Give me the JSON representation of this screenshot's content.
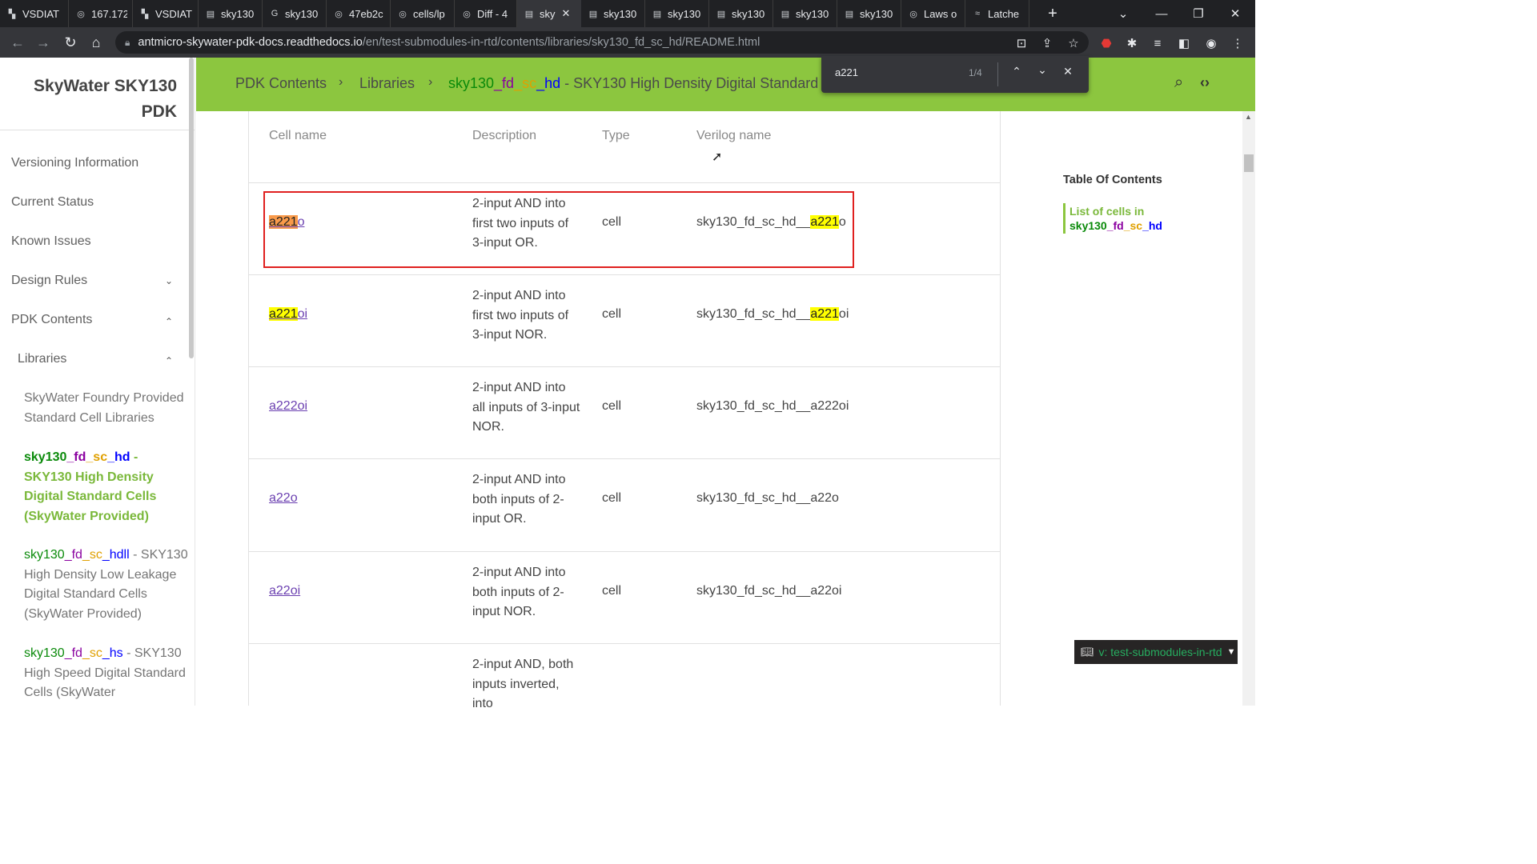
{
  "tabs": [
    {
      "label": "VSDIAT",
      "icon": "vsdiat-icon",
      "width": 86
    },
    {
      "label": "167.172",
      "icon": "globe-icon",
      "width": 80
    },
    {
      "label": "VSDIAT",
      "icon": "vsdiat-icon",
      "width": 82
    },
    {
      "label": "sky130",
      "icon": "doc-icon",
      "width": 80
    },
    {
      "label": "sky130",
      "icon": "google-icon",
      "width": 80
    },
    {
      "label": "47eb2c",
      "icon": "globe-icon",
      "width": 80
    },
    {
      "label": "cells/lp",
      "icon": "globe-icon",
      "width": 80
    },
    {
      "label": "Diff - 4",
      "icon": "globe-icon",
      "width": 78
    },
    {
      "label": "sky",
      "icon": "doc-icon",
      "width": 80,
      "active": true
    },
    {
      "label": "sky130",
      "icon": "doc-icon",
      "width": 80
    },
    {
      "label": "sky130",
      "icon": "doc-icon",
      "width": 80
    },
    {
      "label": "sky130",
      "icon": "doc-icon",
      "width": 80
    },
    {
      "label": "sky130",
      "icon": "doc-icon",
      "width": 80
    },
    {
      "label": "sky130",
      "icon": "doc-icon",
      "width": 80
    },
    {
      "label": "Laws o",
      "icon": "globe-icon",
      "width": 80
    },
    {
      "label": "Latche",
      "icon": "pages-icon",
      "width": 80
    }
  ],
  "url": {
    "domain": "antmicro-skywater-pdk-docs.readthedocs.io",
    "path": "/en/test-submodules-in-rtd/contents/libraries/sky130_fd_sc_hd/README.html"
  },
  "sidebar": {
    "brand_line1": "SkyWater SKY130",
    "brand_line2": "PDK",
    "items": [
      "Versioning Information",
      "Current Status",
      "Known Issues",
      "Design Rules",
      "PDK Contents",
      "Libraries"
    ],
    "sub_foundry": "SkyWater Foundry Provided Standard Cell Libraries",
    "hd": {
      "p1": "sky130",
      "p2": "_fd",
      "p3": "_sc",
      "p4": "_hd",
      "rest": " - SKY130 High Density Digital Standard Cells (SkyWater Provided)"
    },
    "hdll": {
      "p1": "sky130",
      "p2": "_fd",
      "p3": "_sc",
      "p4": "_hdll",
      "rest": " - SKY130 High Density Low Leakage Digital Standard Cells (SkyWater Provided)"
    },
    "hs": {
      "p1": "sky130",
      "p2": "_fd",
      "p3": "_sc",
      "p4": "_hs",
      "rest": " - SKY130 High Speed Digital Standard Cells (SkyWater"
    }
  },
  "header": {
    "crumb1": "PDK Contents",
    "crumb2": "Libraries",
    "crumb3": {
      "p1": "sky130",
      "p2": "_fd",
      "p3": "_sc",
      "p4": "_hd",
      "rest": " - SKY130 High Density Digital Standard"
    }
  },
  "findbar": {
    "query": "a221",
    "count": "1/4"
  },
  "table": {
    "headers": [
      "Cell name",
      "Description",
      "Type",
      "Verilog name"
    ],
    "rows": [
      {
        "hl": "a221",
        "rest": "o",
        "desc": "2-input AND into first two inputs of 3-input OR.",
        "type": "cell",
        "vprefix": "sky130_fd_sc_hd__",
        "vhl": "a221",
        "vrest": "o"
      },
      {
        "hl": "a221",
        "rest": "oi",
        "desc": "2-input AND into first two inputs of 3-input NOR.",
        "type": "cell",
        "vprefix": "sky130_fd_sc_hd__",
        "vhl": "a221",
        "vrest": "oi"
      },
      {
        "hl": "",
        "rest": "a222oi",
        "desc": "2-input AND into all inputs of 3-input NOR.",
        "type": "cell",
        "vprefix": "sky130_fd_sc_hd__",
        "vhl": "",
        "vrest": "a222oi"
      },
      {
        "hl": "",
        "rest": "a22o",
        "desc": "2-input AND into both inputs of 2-input OR.",
        "type": "cell",
        "vprefix": "sky130_fd_sc_hd__",
        "vhl": "",
        "vrest": "a22o"
      },
      {
        "hl": "",
        "rest": "a22oi",
        "desc": "2-input AND into both inputs of 2-input NOR.",
        "type": "cell",
        "vprefix": "sky130_fd_sc_hd__",
        "vhl": "",
        "vrest": "a22oi"
      },
      {
        "hl": "",
        "rest": "",
        "desc": "2-input AND, both inputs inverted, into",
        "type": "",
        "vprefix": "",
        "vhl": "",
        "vrest": ""
      }
    ]
  },
  "toc": {
    "title": "Table Of Contents",
    "link1": "List of cells in",
    "p1": "sky130",
    "p2": "_fd",
    "p3": "_sc",
    "p4": "_hd"
  },
  "rtd_badge": "v: test-submodules-in-rtd"
}
